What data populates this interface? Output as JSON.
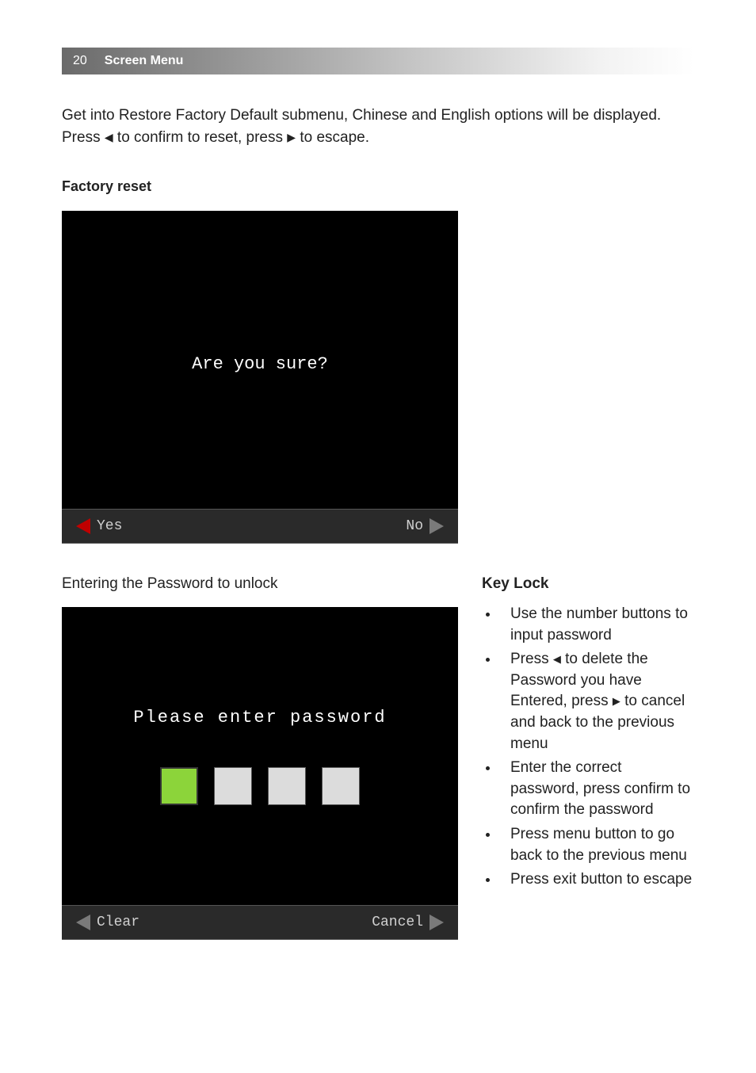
{
  "header": {
    "page_number": "20",
    "title": "Screen Menu"
  },
  "intro": {
    "line1_a": "Get into Restore Factory Default submenu, Chinese and English options will be ",
    "line1_b": "displayed. Press ",
    "line1_c": " to confirm to reset, press ",
    "line1_d": " to escape."
  },
  "sections": {
    "factory_reset_title": "Factory reset",
    "password_title": "Entering the Password to unlock",
    "keylock_title": "Key Lock"
  },
  "screenshot1": {
    "prompt": "Are you sure?",
    "left": "Yes",
    "right": "No"
  },
  "screenshot2": {
    "prompt": "Please enter password",
    "left": "Clear",
    "right": "Cancel"
  },
  "keylock": {
    "item1": "Use the number buttons to input password",
    "item2_a": "Press ",
    "item2_b": " to delete the Password you have Entered, press ",
    "item2_c": " to cancel and back to the previous menu",
    "item3": "Enter the correct password, press confirm to confirm the password",
    "item4": "Press menu button to go back to the previous menu",
    "item5": "Press exit button to escape"
  }
}
